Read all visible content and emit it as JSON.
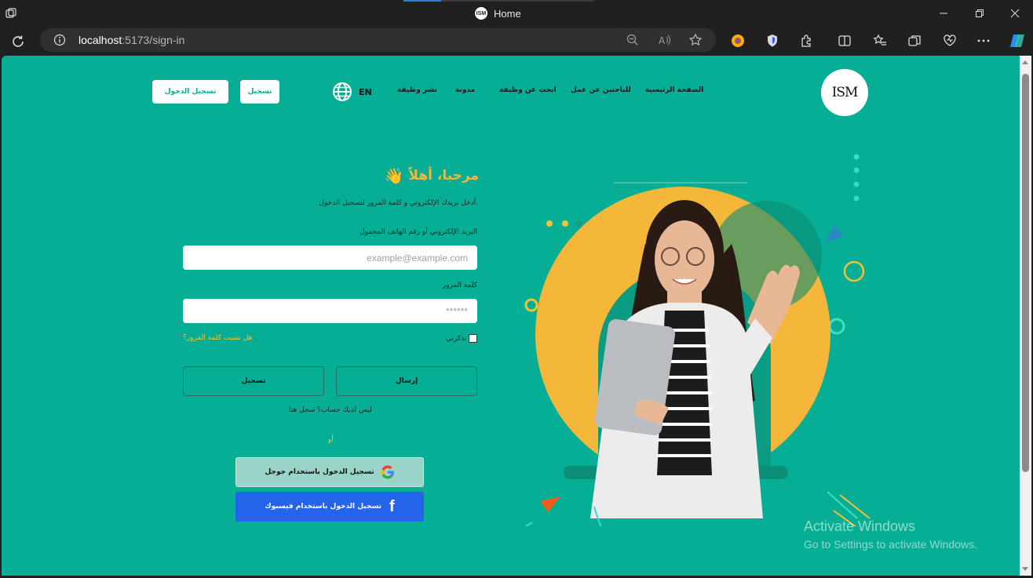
{
  "browser": {
    "tab_title": "Home",
    "favicon_text": "ISM",
    "url_host": "localhost",
    "url_path": ":5173/sign-in"
  },
  "header": {
    "logo_text": "ISM",
    "nav": [
      "الصفحة الرئيسية",
      "للباحثين عن عمل",
      "ابحث عن وظيفة",
      "مدونة",
      "نشر وظيفة"
    ],
    "lang": "EN",
    "register_label": "تسجيل",
    "login_label": "تسجيل الدخول"
  },
  "form": {
    "welcome": "مرحبا، أهلاً",
    "subtitle": "أدخل بريدك الإلكتروني و كلمة المرور لتسجيل الدخول.",
    "email_label": "البريد الإلكتروني أو رقم الهاتف المحمول",
    "email_placeholder": "example@example.com",
    "password_label": "كلمه المرور",
    "password_placeholder": "******",
    "remember_label": "تذكرني",
    "forgot_label": "هل نسيت كلمة المرور؟",
    "submit_label": "إرسال",
    "register_label": "تسجيل",
    "no_account": "ليس لديك حساب؟ سجل هنا",
    "or": "أو",
    "google_label": "تسجيل الدخول باستخدام جوجل",
    "facebook_label": "تسجيل الدخول باستخدام فيسبوك"
  },
  "watermark": {
    "line1": "Activate Windows",
    "line2": "Go to Settings to activate Windows."
  },
  "colors": {
    "page_bg": "#05ae94",
    "accent_yellow": "#f3c22e",
    "facebook_blue": "#2563eb"
  }
}
